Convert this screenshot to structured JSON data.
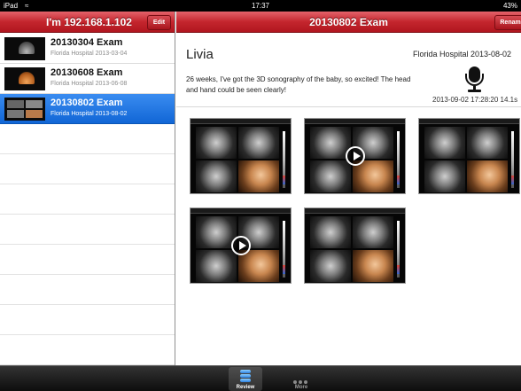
{
  "status_bar": {
    "carrier": "iPad",
    "wifi_icon": "wifi-icon",
    "time": "17:37",
    "battery": "43%"
  },
  "left_pane": {
    "title": "I'm 192.168.1.102",
    "edit_label": "Edit",
    "exams": [
      {
        "name": "20130304 Exam",
        "subtitle": "Florida Hospital 2013-03-04",
        "selected": false
      },
      {
        "name": "20130608 Exam",
        "subtitle": "Florida Hospital 2013-06-08",
        "selected": false
      },
      {
        "name": "20130802 Exam",
        "subtitle": "Florida Hospital 2013-08-02",
        "selected": true
      }
    ]
  },
  "detail": {
    "title": "20130802 Exam",
    "rename_label": "Rename",
    "patient_name": "Livia",
    "hospital_date": "Florida Hospital  2013-08-02",
    "note": "26 weeks, I've got the 3D sonography of the baby, so excited! The head and hand could be seen clearly!",
    "timestamp": "2013-09-02 17:28:20 14.1s",
    "media": [
      {
        "kind": "image",
        "has_play": false
      },
      {
        "kind": "video",
        "has_play": true
      },
      {
        "kind": "image",
        "has_play": false
      },
      {
        "kind": "video",
        "has_play": true
      },
      {
        "kind": "image",
        "has_play": false
      }
    ]
  },
  "tab_bar": {
    "tabs": [
      {
        "label": "Review",
        "icon": "database-icon",
        "active": true
      },
      {
        "label": "More",
        "icon": "more-dots-icon",
        "active": false
      }
    ]
  },
  "colors": {
    "nav_red": "#c4262e",
    "selection_blue": "#1166d6",
    "tab_bar": "#111111"
  }
}
